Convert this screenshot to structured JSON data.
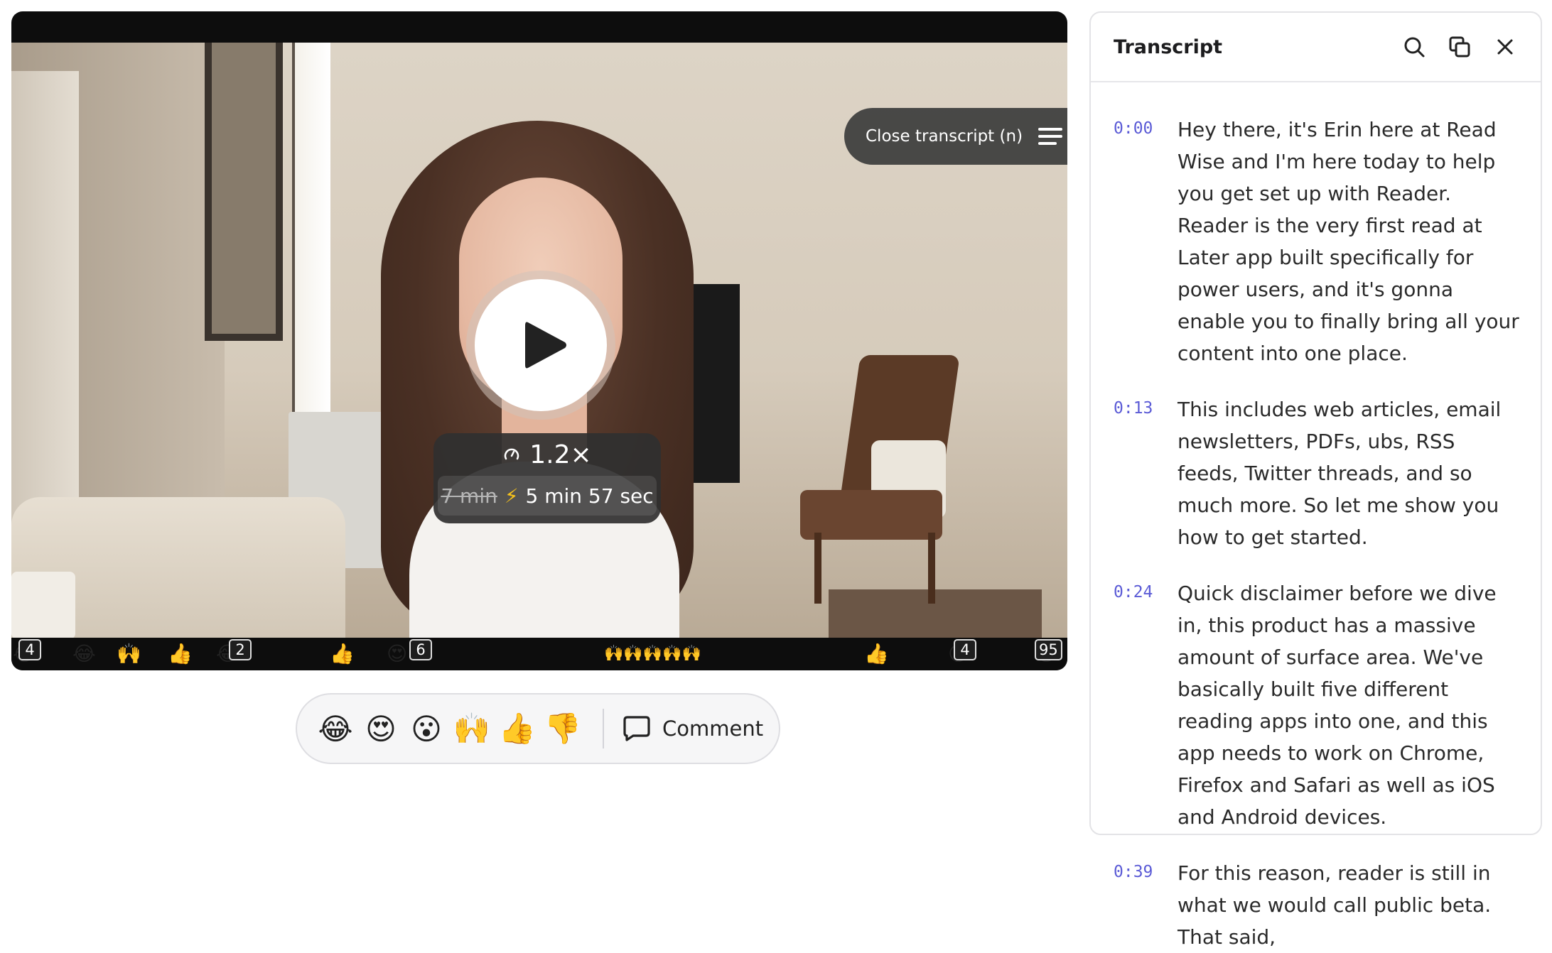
{
  "video": {
    "close_transcript_label": "Close transcript (n)",
    "speed": "1.2×",
    "original_duration": "7 min",
    "new_duration": "5 min 57 sec",
    "reaction_timeline": [
      {
        "emoji": "😂",
        "count": "4"
      },
      {
        "emoji": "😂"
      },
      {
        "emoji": "🙌"
      },
      {
        "emoji": "👍"
      },
      {
        "emoji": "😂",
        "count": "2"
      },
      {
        "emoji": "👍"
      },
      {
        "emoji": "😍",
        "count": "6"
      },
      {
        "emoji": "🙌🙌🙌🙌🙌"
      },
      {
        "emoji": "👍"
      },
      {
        "emoji": "😮",
        "count": "4"
      },
      {
        "emoji": "😂",
        "count": "95"
      }
    ]
  },
  "reactions": {
    "buttons": [
      "😂",
      "😍",
      "😮",
      "🙌",
      "👍",
      "👎"
    ],
    "comment_label": "Comment"
  },
  "transcript": {
    "title": "Transcript",
    "segments": [
      {
        "time": "0:00",
        "text": "Hey there, it's Erin here at Read Wise and I'm here today to help you get set up with Reader. Reader is the very first read at Later app built specifically for power users, and it's gonna enable you to finally bring all your content into one place."
      },
      {
        "time": "0:13",
        "text": "This includes web articles, email newsletters, PDFs, ubs, RSS feeds, Twitter threads, and so much more. So let me show you how to get started."
      },
      {
        "time": "0:24",
        "text": "Quick disclaimer before we dive in, this product has a massive amount of surface area. We've basically built five different reading apps into one, and this app needs to work on Chrome, Firefox and Safari as well as iOS and Android devices."
      },
      {
        "time": "0:39",
        "text": "For this reason, reader is still in what we would call public beta. That said,"
      }
    ]
  }
}
